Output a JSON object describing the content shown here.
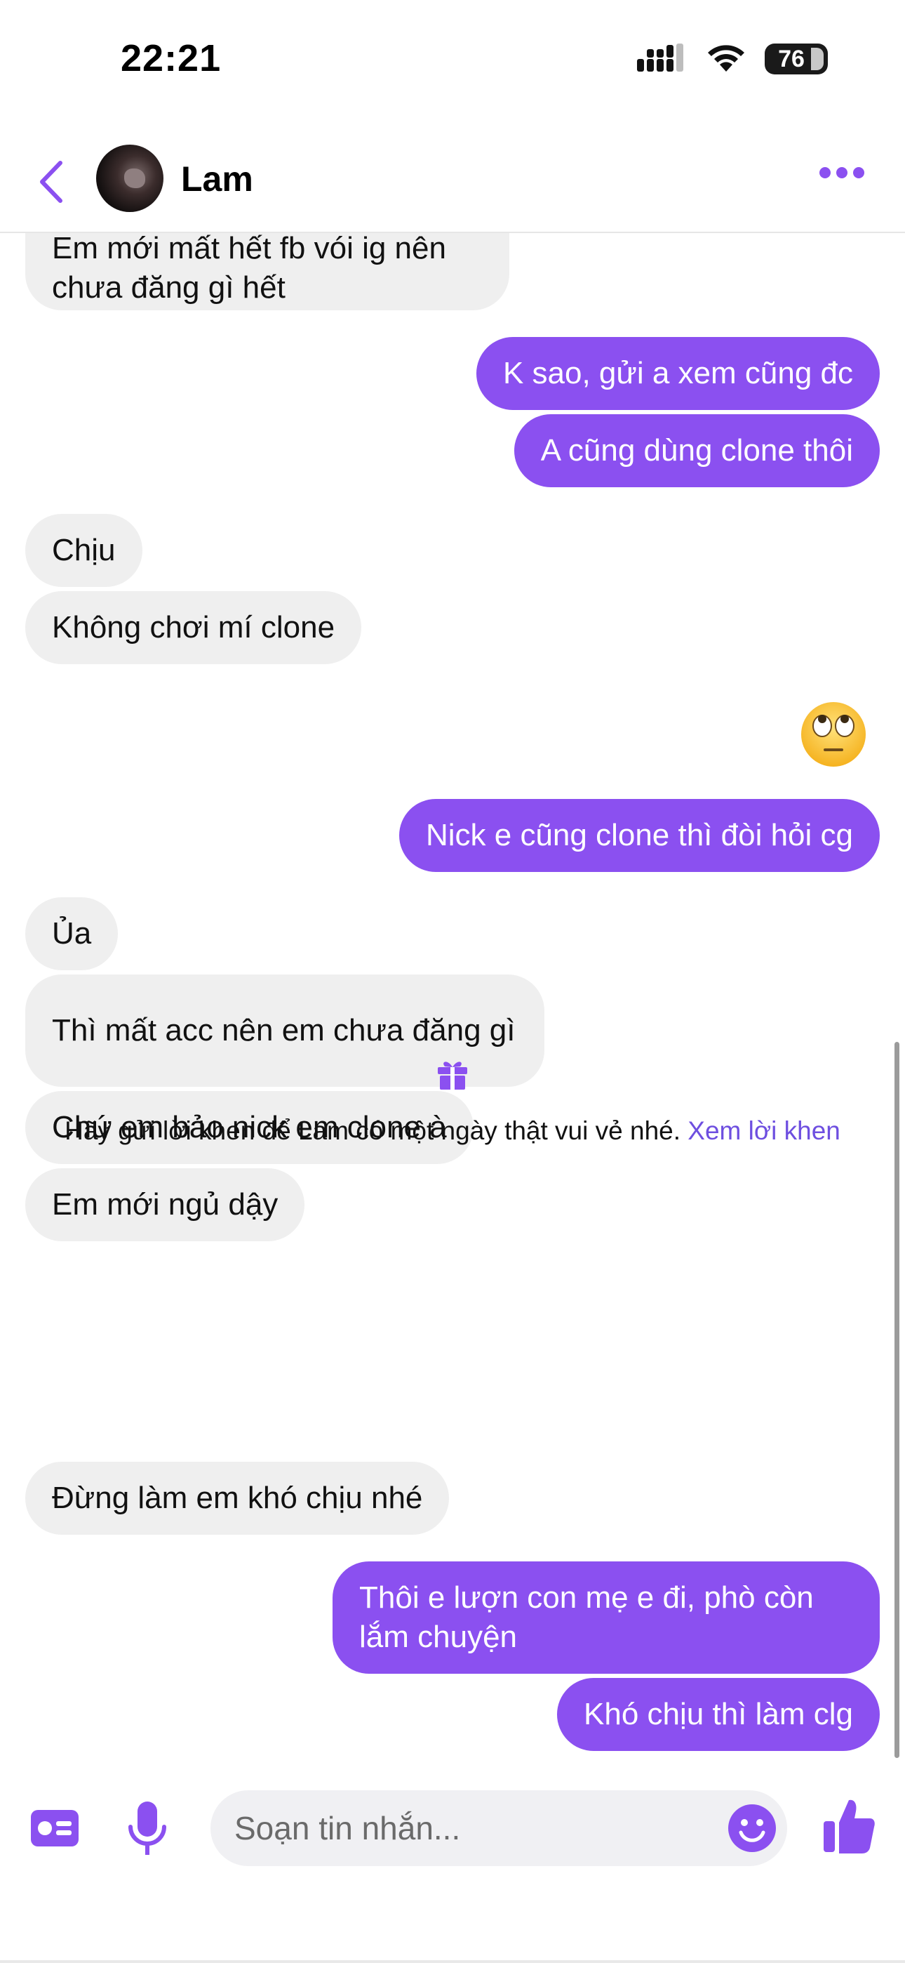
{
  "status_bar": {
    "time": "22:21",
    "battery": "76"
  },
  "header": {
    "contact_name": "Lam"
  },
  "messages": [
    {
      "dir": "in",
      "text": "Em mới mất hết fb vói ig nên chưa đăng gì hết"
    },
    {
      "dir": "out",
      "text": "K sao, gửi a xem cũng đc"
    },
    {
      "dir": "out",
      "text": "A cũng dùng clone thôi"
    },
    {
      "dir": "in",
      "text": "Chịu"
    },
    {
      "dir": "in",
      "text": "Không chơi mí clone"
    },
    {
      "dir": "out",
      "emoji": "face-with-rolling-eyes"
    },
    {
      "dir": "out",
      "text": "Nick e cũng clone thì đòi hỏi cg"
    },
    {
      "dir": "in",
      "text": "Ủa"
    },
    {
      "dir": "in",
      "text": "Thì mất acc nên em chưa đăng gì"
    },
    {
      "dir": "in",
      "text": "Chứ em bảo nick em clone à"
    },
    {
      "dir": "in",
      "text": "Em mới ngủ dậy"
    },
    {
      "dir": "in",
      "text": "Đừng làm em khó chịu nhé"
    },
    {
      "dir": "out",
      "text": "Thôi e lượn con mẹ e đi, phò còn lắm chuyện"
    },
    {
      "dir": "out",
      "text": "Khó chịu thì làm clg"
    }
  ],
  "system_notice": {
    "text": "Hãy gửi lời khen để Lam có một ngày thật vui vẻ nhé.",
    "link": "Xem lời khen"
  },
  "composer": {
    "placeholder": "Soạn tin nhắn..."
  },
  "colors": {
    "accent": "#8b50f0",
    "incoming_bubble": "#efefef",
    "link": "#6e4fe0"
  }
}
